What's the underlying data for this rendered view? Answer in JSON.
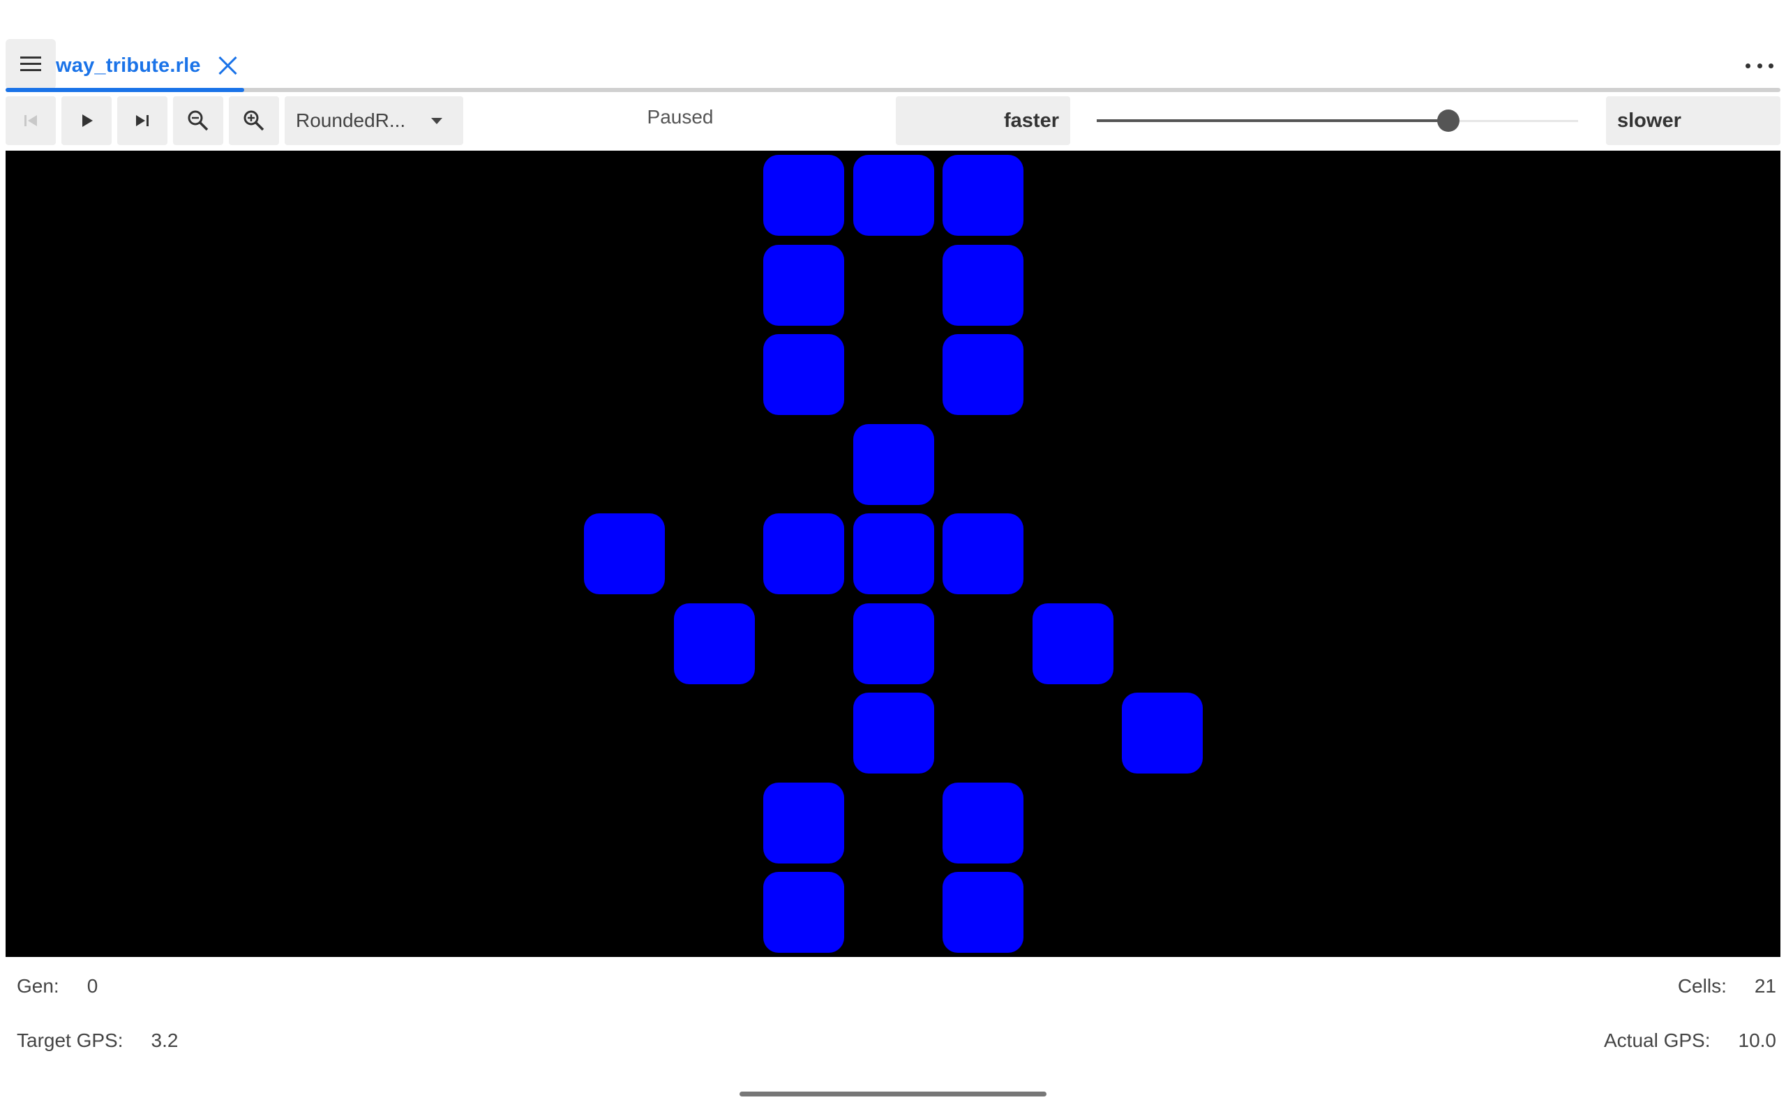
{
  "tab": {
    "title": "way_tribute.rle"
  },
  "toolbar": {
    "renderer": "RoundedR...",
    "status": "Paused",
    "faster_label": "faster",
    "slower_label": "slower",
    "speed_slider_fraction": 0.73
  },
  "grid": {
    "cell_color": "#0000ff",
    "background": "#000000",
    "live_cells": [
      [
        4,
        0
      ],
      [
        5,
        0
      ],
      [
        6,
        0
      ],
      [
        4,
        1
      ],
      [
        6,
        1
      ],
      [
        4,
        2
      ],
      [
        6,
        2
      ],
      [
        5,
        3
      ],
      [
        2,
        4
      ],
      [
        4,
        4
      ],
      [
        5,
        4
      ],
      [
        6,
        4
      ],
      [
        3,
        5
      ],
      [
        5,
        5
      ],
      [
        7,
        5
      ],
      [
        5,
        6
      ],
      [
        8,
        6
      ],
      [
        4,
        7
      ],
      [
        6,
        7
      ],
      [
        4,
        8
      ],
      [
        6,
        8
      ]
    ]
  },
  "stats": {
    "gen_label": "Gen:",
    "gen_value": "0",
    "cells_label": "Cells:",
    "cells_value": "21",
    "target_label": "Target GPS:",
    "target_value": "3.2",
    "actual_label": "Actual GPS:",
    "actual_value": "10.0"
  },
  "colors": {
    "accent": "#1a73e8",
    "button_bg": "#eeeeee"
  },
  "icons": [
    "menu-icon",
    "close-icon",
    "more-icon",
    "skip-start-icon",
    "play-icon",
    "step-icon",
    "zoom-out-icon",
    "zoom-in-icon",
    "caret-down-icon"
  ]
}
